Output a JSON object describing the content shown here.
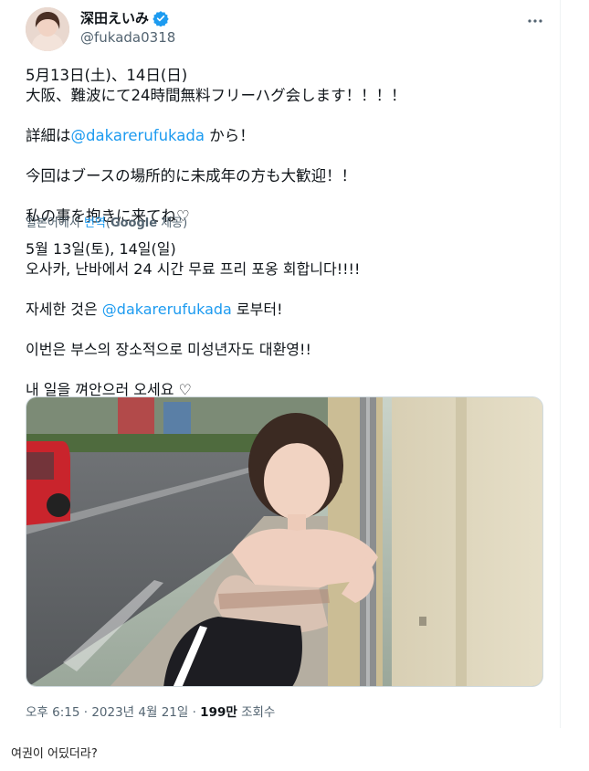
{
  "author": {
    "display_name": "深田えいみ",
    "handle": "@fukada0318",
    "verified_color": "#1d9bf0"
  },
  "tweet": {
    "ja_line1": "5月13日(土)、14日(日)",
    "ja_line2": "大阪、難波にて24時間無料フリーハグ会します！！！！",
    "ja_line3_prefix": "詳細は",
    "ja_line3_mention": "@dakarerufukada",
    "ja_line3_suffix": " から！",
    "ja_line4": "今回はブースの場所的に未成年の方も大歓迎！！",
    "ja_line5": "私の事を抱きに来てね♡"
  },
  "translation": {
    "prefix": "일본어에서 ",
    "link": "번역",
    "paren_open": "(",
    "google": "Google",
    "suffix": " 제공)"
  },
  "translated": {
    "ko_line1": "5월 13일(토), 14일(일)",
    "ko_line2": "오사카, 난바에서 24 시간 무료 프리 포옹 회합니다!!!!",
    "ko_line3_prefix": "자세한 것은 ",
    "ko_line3_mention": "@dakarerufukada",
    "ko_line3_suffix": " 로부터!",
    "ko_line4": "이번은 부스의 장소적으로 미성년자도 대환영!!",
    "ko_line5": "내 일을 껴안으러 오세요 ♡"
  },
  "meta": {
    "time": "오후 6:15 · 2023년 4월 21일 · ",
    "views_count": "199만",
    "views_label": " 조회수"
  },
  "comment": {
    "text": "여권이 어딨더라?"
  },
  "colors": {
    "link": "#1d9bf0",
    "secondary_text": "#536471",
    "primary_text": "#0f1419"
  }
}
